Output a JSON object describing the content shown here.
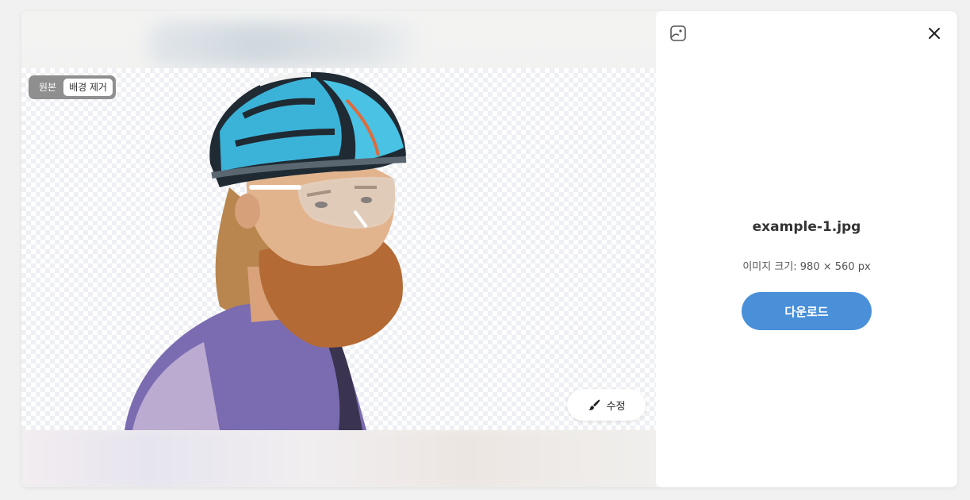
{
  "preview": {
    "toggle": {
      "original_label": "원본",
      "removed_label": "배경 제거",
      "active": "배경 제거"
    },
    "edit_button_label": "수정"
  },
  "panel": {
    "logo_icon": "image-icon",
    "close_icon": "close-icon",
    "file_name": "example-1.jpg",
    "image_size_text": "이미지 크기: 980 × 560 px",
    "download_label": "다운로드"
  },
  "colors": {
    "accent": "#4a90d9",
    "toggle_bg": "#8f8f8f"
  }
}
